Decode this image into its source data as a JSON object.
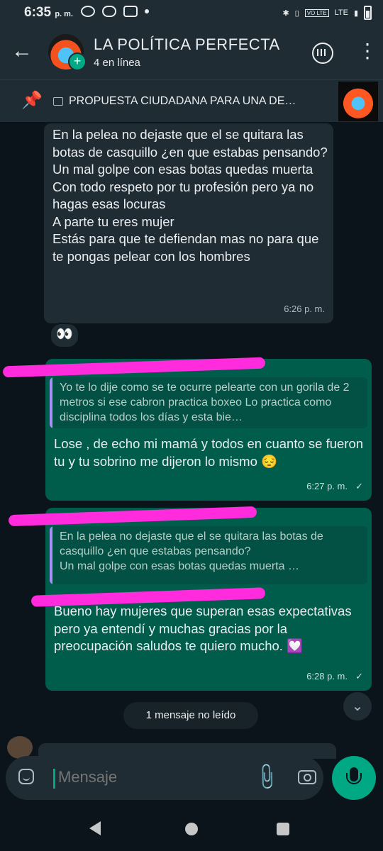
{
  "status_bar": {
    "time": "6:35",
    "ampm": "p. m.",
    "network": "LTE",
    "vo_lte": "VO LTE"
  },
  "header": {
    "title": "LA POLÍTICA PERFECTA",
    "subtitle": "4 en línea"
  },
  "pinned": {
    "text": "PROPUESTA CIUDADANA PARA UNA DE…"
  },
  "messages": [
    {
      "direction": "incoming",
      "text": "En la pelea no dejaste que el se quitara las botas de casquillo ¿en que estabas pensando?\nUn mal golpe con esas botas quedas muerta\nCon todo respeto por tu profesión pero ya no hagas esas locuras\nA parte tu eres mujer\nEstás para que te defiendan mas no para que te pongas pelear con los hombres",
      "time": "6:26 p. m.",
      "reaction": "👀"
    },
    {
      "direction": "outgoing",
      "quoted_text": "Yo te lo dije como se te ocurre pelearte con un gorila de 2 metros si ese cabron practica boxeo Lo practica como disciplina todos los días y  esta bie…",
      "text": "Lose , de echo mi mamá y todos en cuanto se fueron tu y tu sobrino me dijeron lo mismo 😔",
      "time": "6:27 p. m.",
      "ticks": "✓"
    },
    {
      "direction": "outgoing",
      "quoted_text": "En la pelea no dejaste que el se quitara las botas de casquillo ¿en que estabas pensando?\nUn mal golpe con esas botas quedas muerta …",
      "text": "Bueno hay mujeres que superan esas expectativas pero ya entendí y muchas gracias por la preocupación saludos te quiero mucho. 💟",
      "time": "6:28 p. m.",
      "ticks": "✓"
    }
  ],
  "unread_banner": "1 mensaje no leído",
  "composer": {
    "placeholder": "Mensaje"
  },
  "colors": {
    "accent": "#00a884",
    "bubble_in": "#202c33",
    "bubble_out": "#005c4b",
    "background": "#0b141a",
    "redaction": "#ff2bdc"
  },
  "icons": [
    "back-arrow-icon",
    "voice-chat-icon",
    "more-vert-icon",
    "pin-icon",
    "image-icon",
    "emoji-icon",
    "attach-icon",
    "camera-icon",
    "mic-icon",
    "chevron-down-icon"
  ]
}
